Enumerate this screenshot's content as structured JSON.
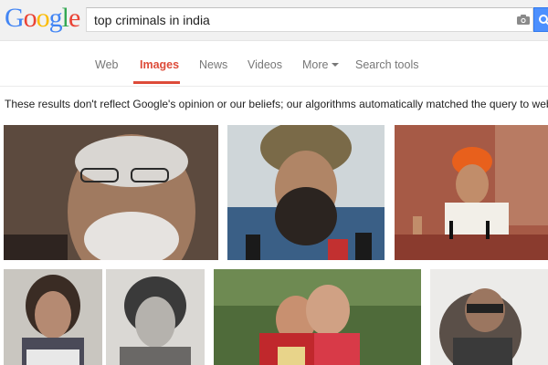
{
  "logo": {
    "letters": [
      {
        "ch": "G",
        "color": "#4285f4"
      },
      {
        "ch": "o",
        "color": "#ea4335"
      },
      {
        "ch": "o",
        "color": "#fbbc05"
      },
      {
        "ch": "g",
        "color": "#4285f4"
      },
      {
        "ch": "l",
        "color": "#34a853"
      },
      {
        "ch": "e",
        "color": "#ea4335"
      }
    ]
  },
  "search": {
    "query": "top criminals in india"
  },
  "nav": {
    "web": "Web",
    "images": "Images",
    "news": "News",
    "videos": "Videos",
    "more": "More",
    "search_tools": "Search tools"
  },
  "disclaimer": "These results don't reflect Google's opinion or our beliefs; our algorithms automatically matched the query to web pages with",
  "icons": {
    "camera": "camera-icon",
    "search": "search-icon",
    "more_dropdown": "chevron-down-icon"
  },
  "colors": {
    "accent_red": "#dd4b39",
    "search_blue": "#4d90fe"
  }
}
